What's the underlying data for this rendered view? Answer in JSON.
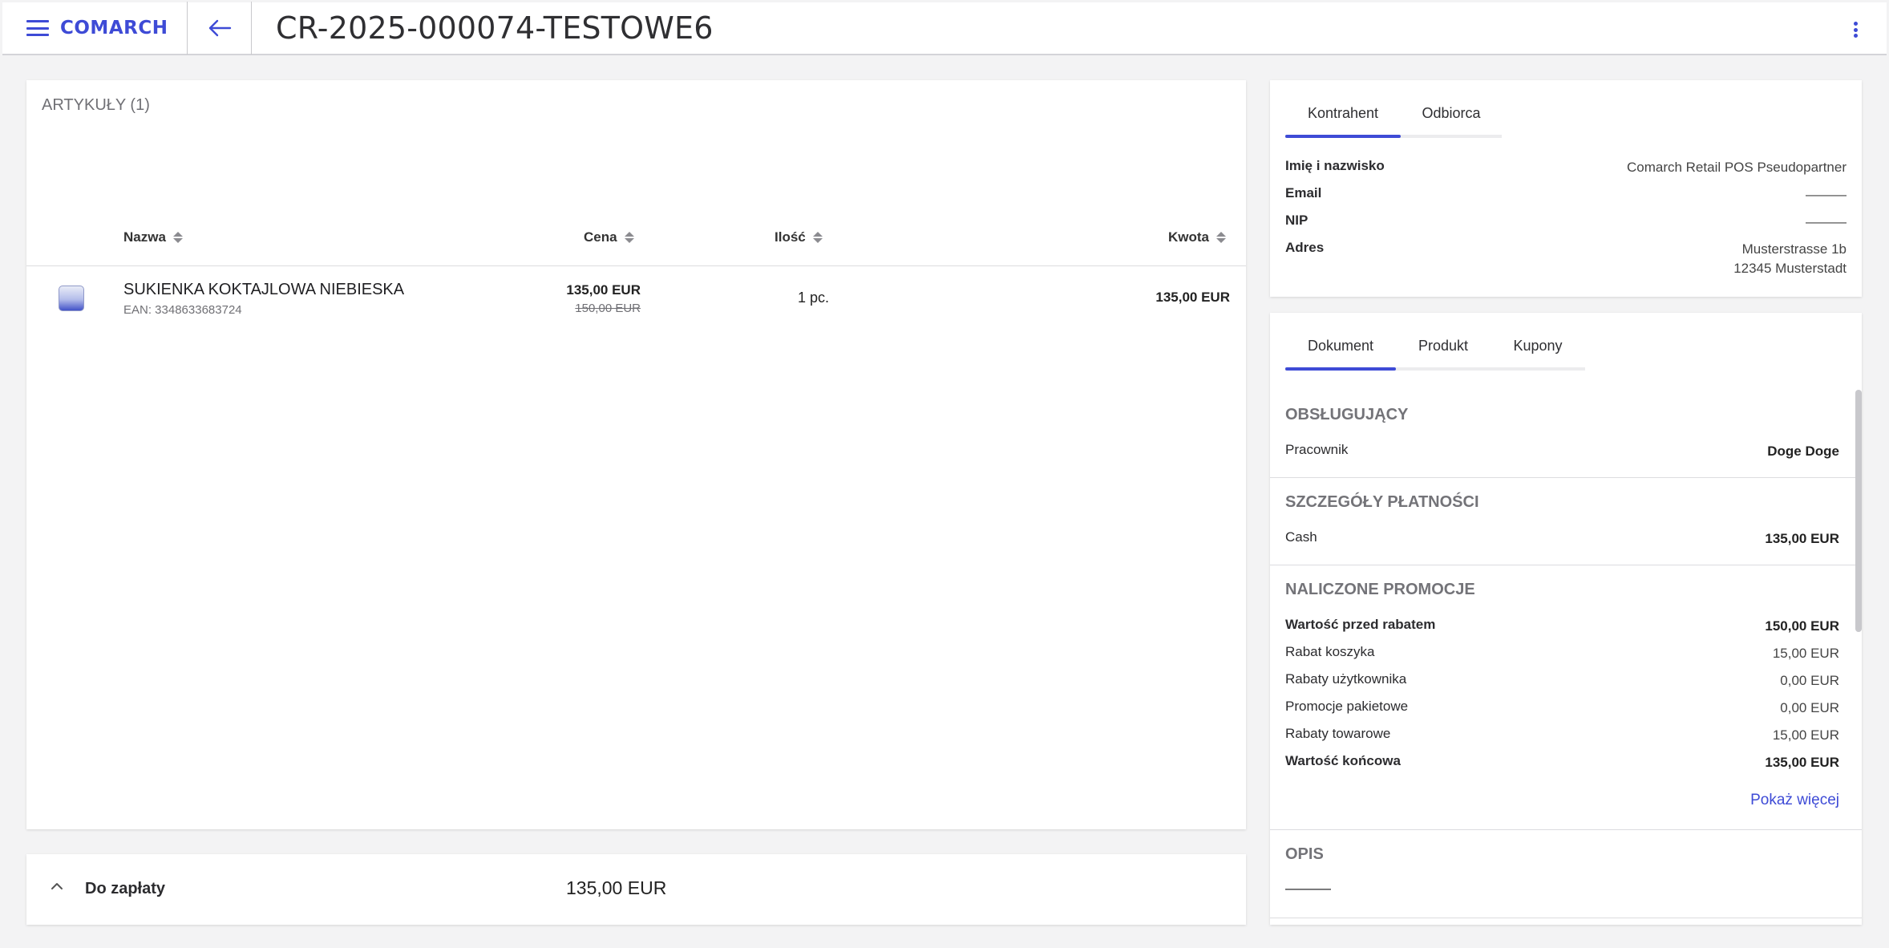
{
  "header": {
    "logo": "COMARCH",
    "title": "CR-2025-000074-TESTOWE6"
  },
  "articles": {
    "section_title": "ARTYKUŁY (1)",
    "columns": [
      "Nazwa",
      "Cena",
      "Ilość",
      "Kwota"
    ],
    "items": [
      {
        "name": "SUKIENKA KOKTAJLOWA NIEBIESKA",
        "ean": "EAN: 3348633683724",
        "price": "135,00 EUR",
        "price_old": "150,00 EUR",
        "qty": "1 pc.",
        "amount": "135,00 EUR"
      }
    ]
  },
  "payment": {
    "label": "Do zapłaty",
    "value": "135,00 EUR"
  },
  "partner": {
    "tabs": [
      "Kontrahent",
      "Odbiorca"
    ],
    "fields": [
      {
        "label": "Imię i nazwisko",
        "value": "Comarch Retail POS Pseudopartner"
      },
      {
        "label": "Email",
        "value": "———"
      },
      {
        "label": "NIP",
        "value": "———"
      },
      {
        "label": "Adres",
        "value_line1": "Musterstrasse 1b",
        "value_line2": "12345 Musterstadt"
      }
    ]
  },
  "document": {
    "tabs": [
      "Dokument",
      "Produkt",
      "Kupony"
    ],
    "staff": {
      "title": "OBSŁUGUJĄCY",
      "label": "Pracownik",
      "value": "Doge Doge"
    },
    "payment_details": {
      "title": "SZCZEGÓŁY PŁATNOŚCI",
      "label": "Cash",
      "value": "135,00 EUR"
    },
    "promotions": {
      "title": "NALICZONE PROMOCJE",
      "rows": [
        {
          "label": "Wartość przed rabatem",
          "value": "150,00 EUR"
        },
        {
          "label": "Rabat koszyka",
          "value": "15,00 EUR"
        },
        {
          "label": "Rabaty użytkownika",
          "value": "0,00 EUR"
        },
        {
          "label": "Promocje pakietowe",
          "value": "0,00 EUR"
        },
        {
          "label": "Rabaty towarowe",
          "value": "15,00 EUR"
        },
        {
          "label": "Wartość końcowa",
          "value": "135,00 EUR"
        }
      ],
      "more": "Pokaż więcej"
    },
    "description": {
      "title": "OPIS",
      "value": "———"
    }
  },
  "colors": {
    "accent": "#3e4bd6",
    "background": "#f3f3f4",
    "muted_text": "#707075"
  },
  "icons": [
    "menu-icon",
    "arrow-left-icon",
    "more-vertical-icon",
    "sort-icon",
    "chevron-up-icon",
    "product-image-icon"
  ]
}
